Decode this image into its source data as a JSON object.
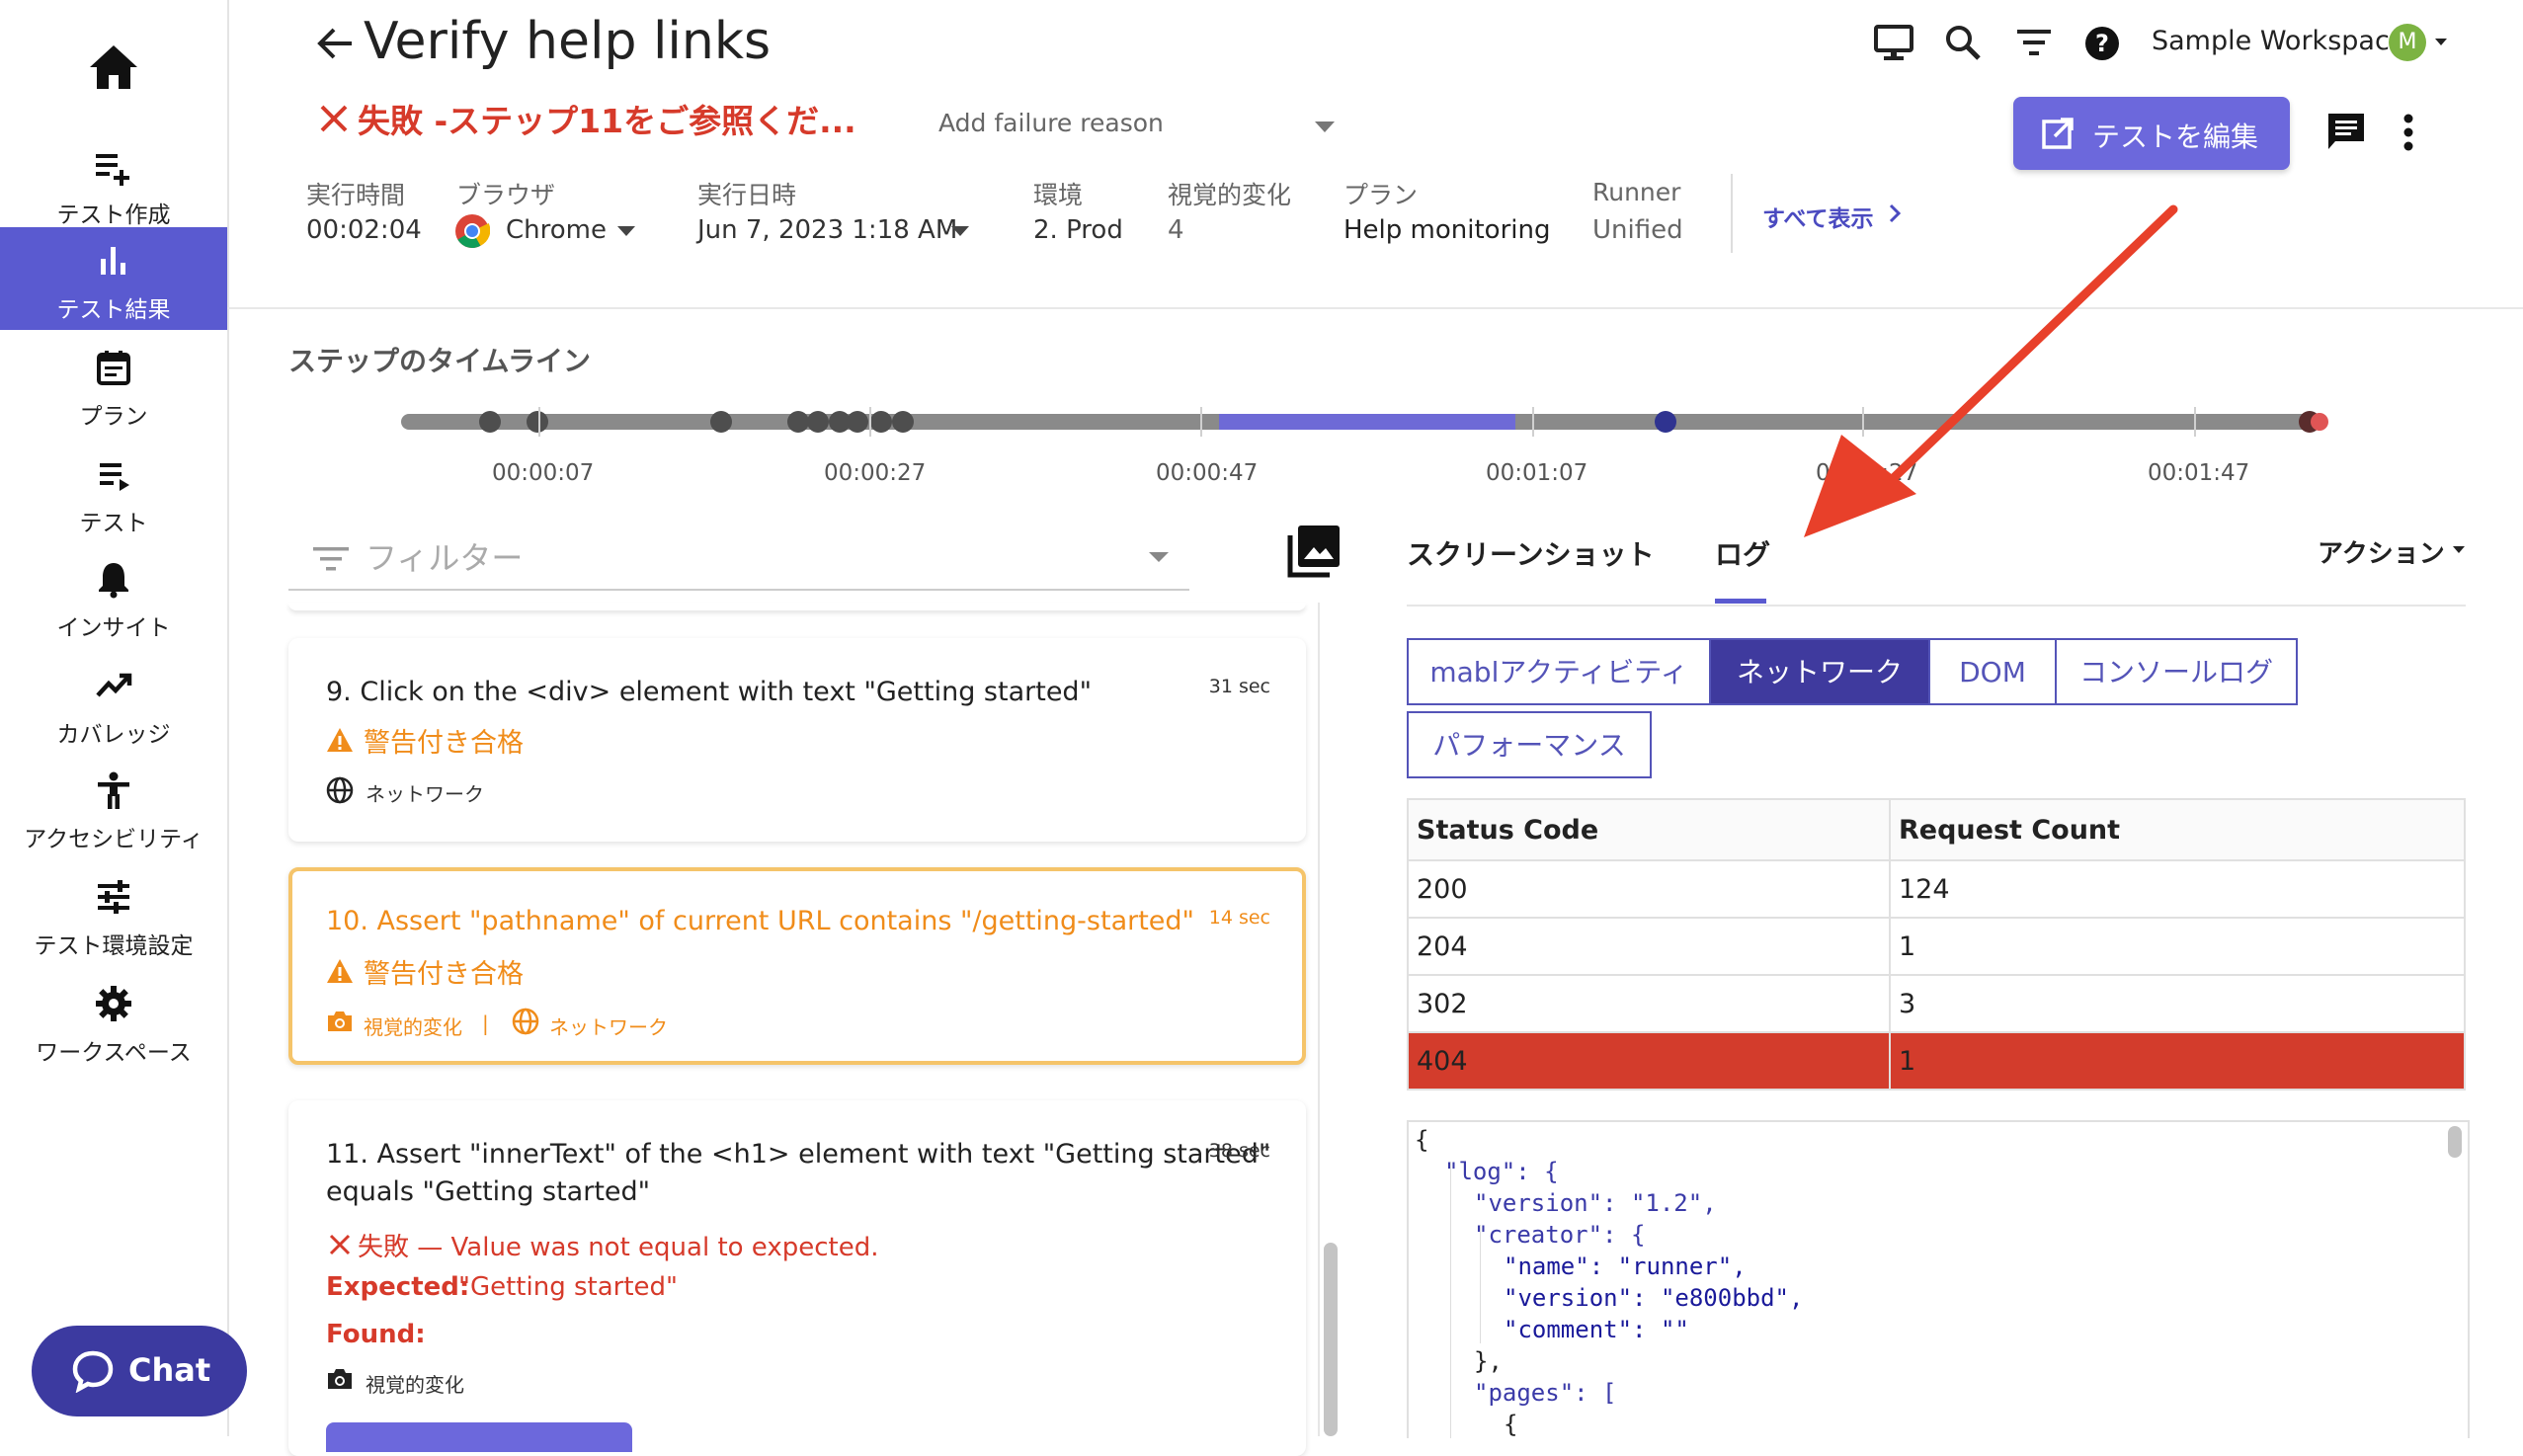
{
  "sidebar": {
    "items": [
      {
        "label": "",
        "icon": "home-icon"
      },
      {
        "label": "テスト作成",
        "icon": "playlist-add-icon"
      },
      {
        "label": "テスト結果",
        "icon": "bar-chart-icon"
      },
      {
        "label": "プラン",
        "icon": "calendar-icon"
      },
      {
        "label": "テスト",
        "icon": "list-icon"
      },
      {
        "label": "インサイト",
        "icon": "bell-icon"
      },
      {
        "label": "カバレッジ",
        "icon": "trending-up-icon"
      },
      {
        "label": "アクセシビリティ",
        "icon": "accessibility-icon"
      },
      {
        "label": "テスト環境設定",
        "icon": "tune-icon"
      },
      {
        "label": "ワークスペース",
        "icon": "gear-icon"
      }
    ],
    "chat_label": "Chat"
  },
  "header": {
    "title": "Verify help links",
    "fail_text": "失敗 -ステップ11をご参照くだ...",
    "failure_reason_placeholder": "Add failure reason",
    "edit_button_label": "テストを編集",
    "workspace_name": "Sample Workspace",
    "avatar_letter": "M",
    "show_all_label": "すべて表示",
    "meta": {
      "duration_label": "実行時間",
      "duration_value": "00:02:04",
      "browser_label": "ブラウザ",
      "browser_value": "Chrome",
      "run_date_label": "実行日時",
      "run_date_value": "Jun 7, 2023 1:18 AM",
      "env_label": "環境",
      "env_value": "2. Prod",
      "visual_label": "視覚的変化",
      "visual_value": "4",
      "plan_label": "プラン",
      "plan_value": "Help monitoring",
      "runner_label": "Runner",
      "runner_value": "Unified"
    }
  },
  "timeline": {
    "title": "ステップのタイムライン",
    "ticks": [
      "00:00:07",
      "00:00:27",
      "00:00:47",
      "00:01:07",
      "00:01:27",
      "00:01:47"
    ]
  },
  "steps": {
    "filter_placeholder": "フィルター",
    "cards": [
      {
        "title": "9. Click on the <div> element with text \"Getting started\"",
        "duration": "31 sec",
        "status": "警告付き合格",
        "tag": "ネットワーク"
      },
      {
        "title": "10. Assert \"pathname\" of current URL contains \"/getting-started\"",
        "duration": "14 sec",
        "status": "警告付き合格",
        "tag1": "視覚的変化",
        "separator": "|",
        "tag2": "ネットワーク"
      },
      {
        "title_line1": "11. Assert \"innerText\" of the <h1> element with text \"Getting started\"",
        "title_line2": "equals \"Getting started\"",
        "duration": "38 sec",
        "status": "失敗 — Value was not equal to expected.",
        "expected_label": "Expected:",
        "expected_value": "\"Getting started\"",
        "found_label": "Found:",
        "tag": "視覚的変化"
      }
    ]
  },
  "panel": {
    "tabs": [
      "スクリーンショット",
      "ログ"
    ],
    "actions_label": "アクション",
    "subtabs": [
      "mablアクティビティ",
      "ネットワーク",
      "DOM",
      "コンソールログ",
      "パフォーマンス"
    ],
    "table": {
      "headers": [
        "Status Code",
        "Request Count"
      ],
      "rows": [
        [
          "200",
          "124"
        ],
        [
          "204",
          "1"
        ],
        [
          "302",
          "3"
        ],
        [
          "404",
          "1"
        ]
      ]
    },
    "code_lines": [
      "{",
      "\"log\": {",
      "\"version\": \"1.2\",",
      "\"creator\": {",
      "\"name\": \"runner\",",
      "\"version\": \"e800bbd\",",
      "\"comment\": \"\"",
      "},",
      "\"pages\": [",
      "{"
    ]
  },
  "colors": {
    "accent": "#5a5ad0",
    "fail": "#d63a2a",
    "warn": "#f08c1a",
    "error_row": "#d33c2c",
    "annotation_arrow": "#e8402a"
  }
}
